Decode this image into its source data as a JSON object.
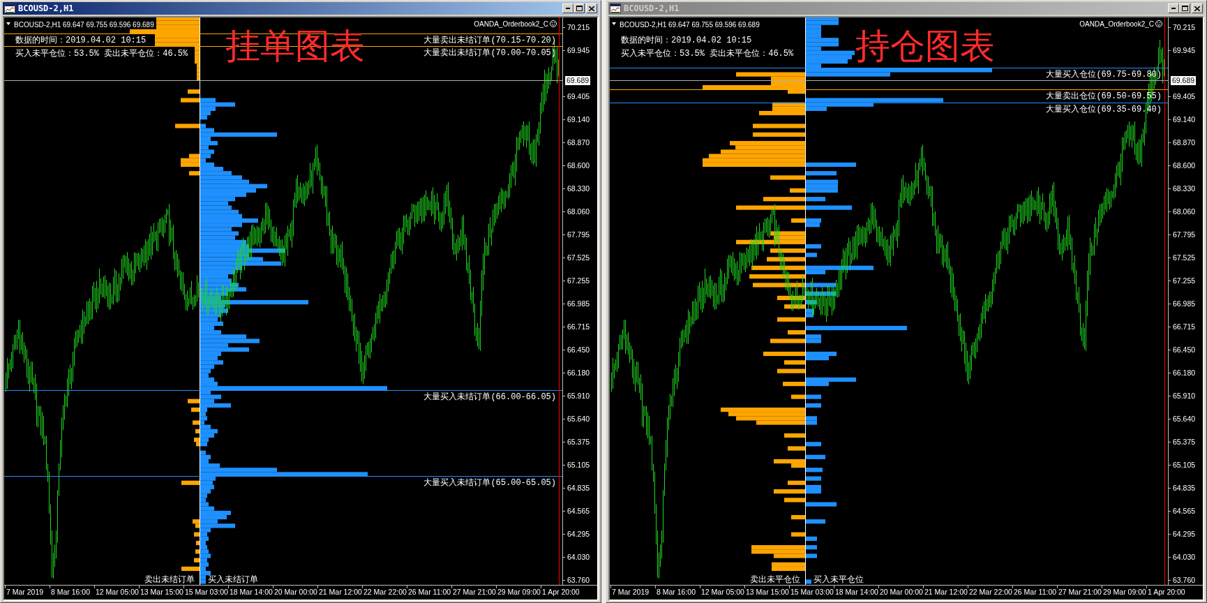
{
  "windows": [
    {
      "title": "BCOUSD-2,H1",
      "active": true,
      "chart": {
        "symbol_info": "BCOUSD-2,H1 69.647 69.755 69.596 69.689",
        "indicator": "OANDA_Orderbook2_C",
        "data_time": "数据的时间：2019.04.02 10:15",
        "position_ratio": "买入未平仓位：53.5% 卖出未平仓位：46.5%",
        "annotation": "挂单图表",
        "levels": [
          {
            "label": "大量卖出未结订单(70.15-70.20)",
            "color": "#ffa500"
          },
          {
            "label": "大量卖出未结订单(70.00-70.05)",
            "color": "#ffa500"
          },
          {
            "label": "大量买入未结订单(66.00-66.05)",
            "color": "#1e90ff"
          },
          {
            "label": "大量买入未结订单(65.00-65.05)",
            "color": "#1e90ff"
          }
        ],
        "sell_label": "卖出未结订单",
        "buy_label": "买入未结订单"
      },
      "price_axis": {
        "ticks": [
          "70.215",
          "69.945",
          "69.405",
          "69.140",
          "68.870",
          "68.600",
          "68.330",
          "68.060",
          "67.795",
          "67.525",
          "67.255",
          "66.985",
          "66.715",
          "66.450",
          "66.180",
          "65.910",
          "65.640",
          "65.375",
          "65.105",
          "64.835",
          "64.565",
          "64.295",
          "64.030",
          "63.760"
        ],
        "current_price": "69.689"
      },
      "time_axis": [
        "7 Mar 2019",
        "8 Mar 16:00",
        "12 Mar 05:00",
        "13 Mar 15:00",
        "15 Mar 03:00",
        "18 Mar 14:00",
        "20 Mar 00:00",
        "21 Mar 12:00",
        "22 Mar 22:00",
        "26 Mar 11:00",
        "27 Mar 21:00",
        "29 Mar 09:00",
        "1 Apr 20:00"
      ]
    },
    {
      "title": "BCOUSD-2,H1",
      "active": false,
      "chart": {
        "symbol_info": "BCOUSD-2,H1 69.647 69.755 69.596 69.689",
        "indicator": "OANDA_Orderbook2_C",
        "data_time": "数据的时间：2019.04.02 10:15",
        "position_ratio": "买入未平仓位：53.5% 卖出未平仓位：46.5%",
        "annotation": "持仓图表",
        "levels": [
          {
            "label": "大量买入仓位(69.75-69.80)",
            "color": "#1e90ff"
          },
          {
            "label": "大量卖出仓位(69.50-69.55)",
            "color": "#ffa500"
          },
          {
            "label": "大量买入仓位(69.35-69.40)",
            "color": "#1e90ff"
          }
        ],
        "sell_label": "卖出未平仓位",
        "buy_label": "买入未平仓位"
      },
      "price_axis": {
        "ticks": [
          "70.215",
          "69.945",
          "69.405",
          "69.140",
          "68.870",
          "68.600",
          "68.330",
          "68.060",
          "67.795",
          "67.525",
          "67.255",
          "66.985",
          "66.715",
          "66.450",
          "66.180",
          "65.910",
          "65.640",
          "65.375",
          "65.105",
          "64.835",
          "64.565",
          "64.295",
          "64.030",
          "63.760"
        ],
        "current_price": "69.689"
      },
      "time_axis": [
        "7 Mar 2019",
        "8 Mar 16:00",
        "12 Mar 05:00",
        "13 Mar 15:00",
        "15 Mar 03:00",
        "18 Mar 14:00",
        "20 Mar 00:00",
        "21 Mar 12:00",
        "22 Mar 22:00",
        "26 Mar 11:00",
        "27 Mar 21:00",
        "29 Mar 09:00",
        "1 Apr 20:00"
      ]
    }
  ]
}
